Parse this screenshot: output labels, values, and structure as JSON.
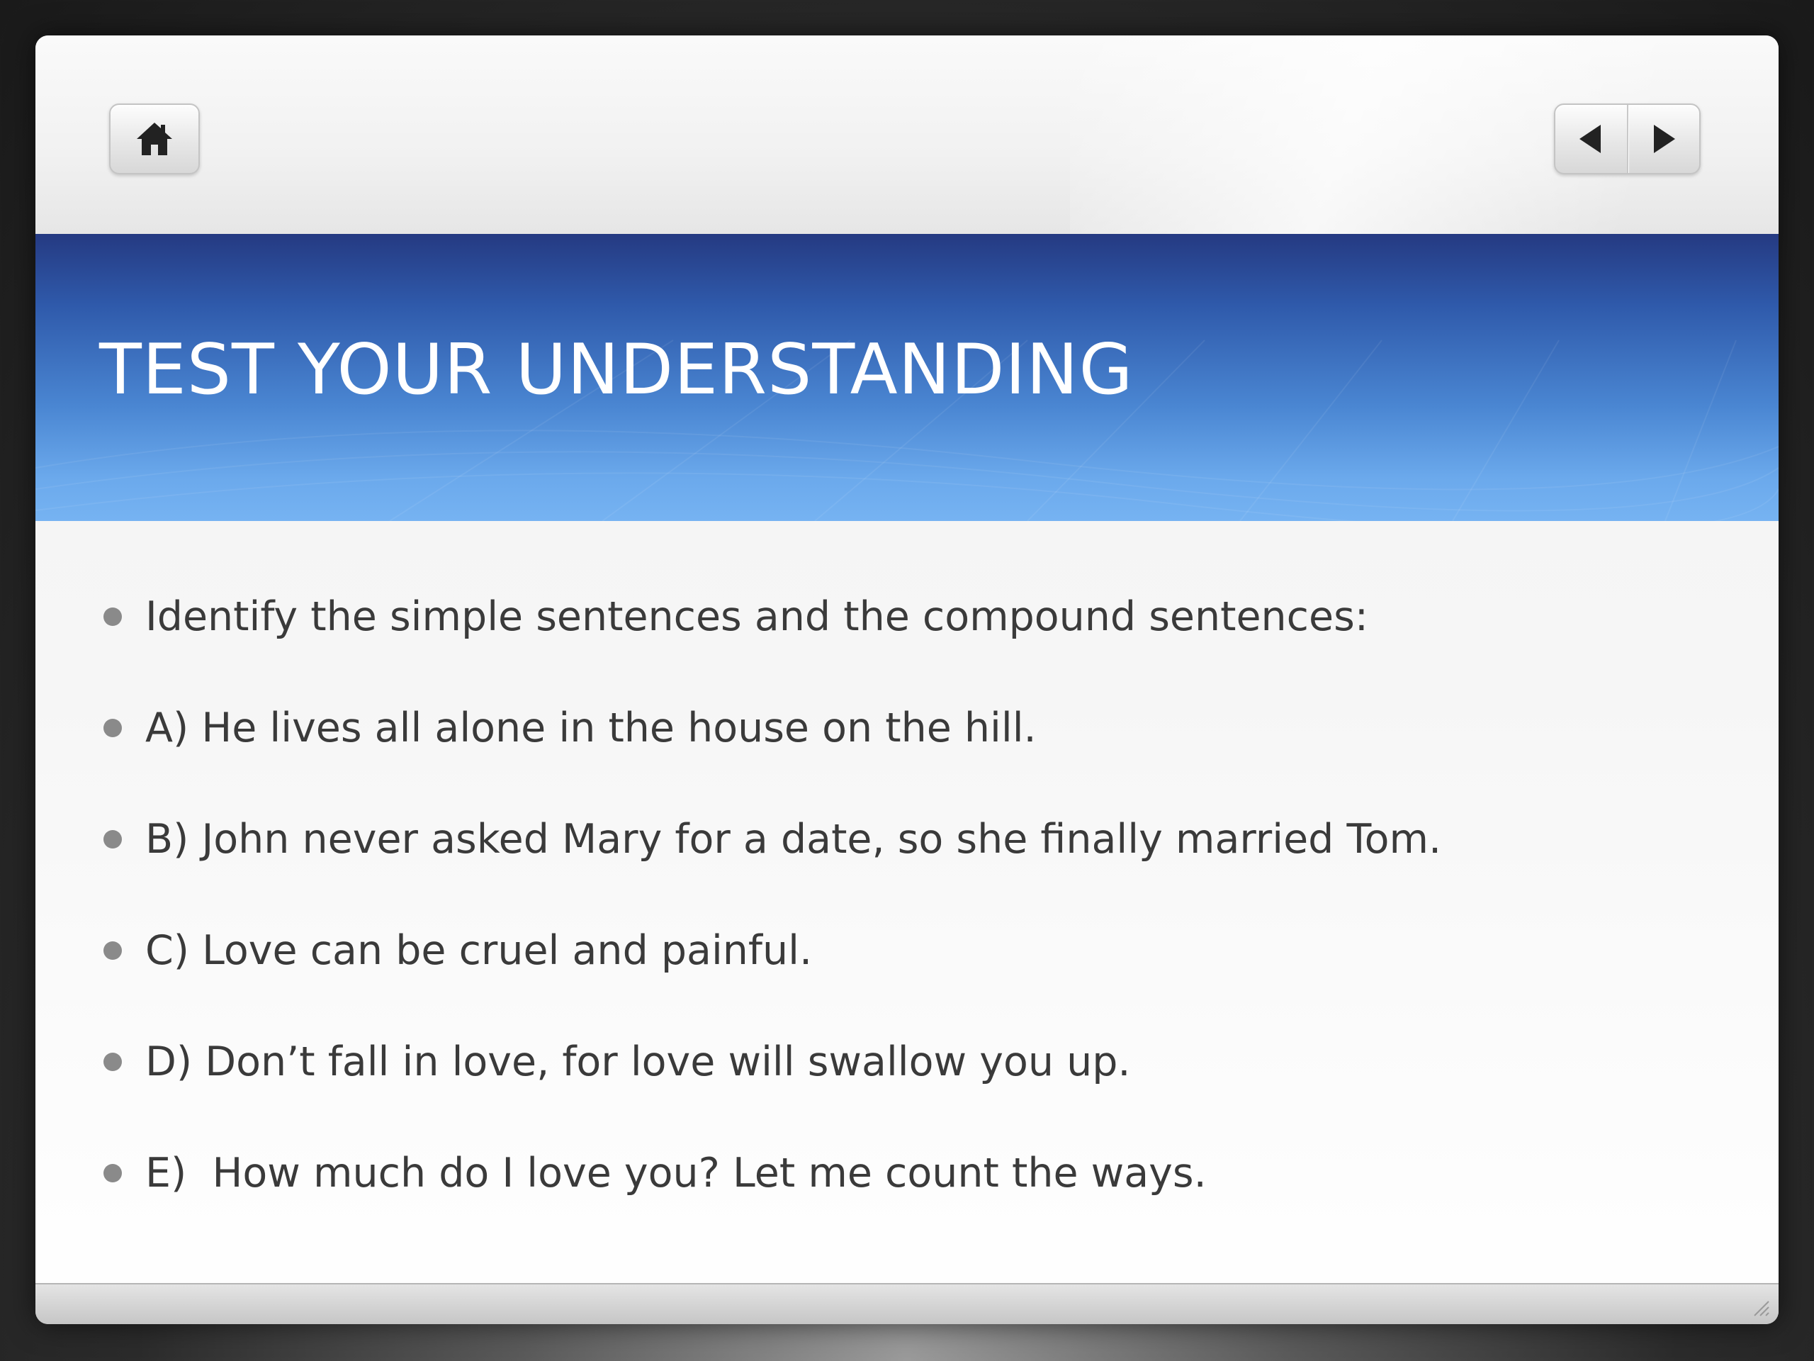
{
  "window": {
    "title": "TEST YOUR UNDERSTANDING"
  },
  "navigation": {
    "home_icon": "home-icon",
    "prev_icon": "triangle-left-icon",
    "next_icon": "triangle-right-icon"
  },
  "bullets": [
    "Identify the simple sentences and the compound sentences:",
    "A) He lives all alone in the house on the hill.",
    "B) John never asked Mary for a date, so she finally married Tom.",
    "C) Love can be cruel and painful.",
    "D) Don’t fall in love, for love will swallow you up.",
    "E)  How much do I love you? Let me count the ways."
  ],
  "colors": {
    "title_band_top": "#253a82",
    "title_band_bottom": "#76b3f2",
    "title_text": "#ffffff",
    "body_text": "#3a3a3a",
    "bullet": "#8a8a8a"
  }
}
